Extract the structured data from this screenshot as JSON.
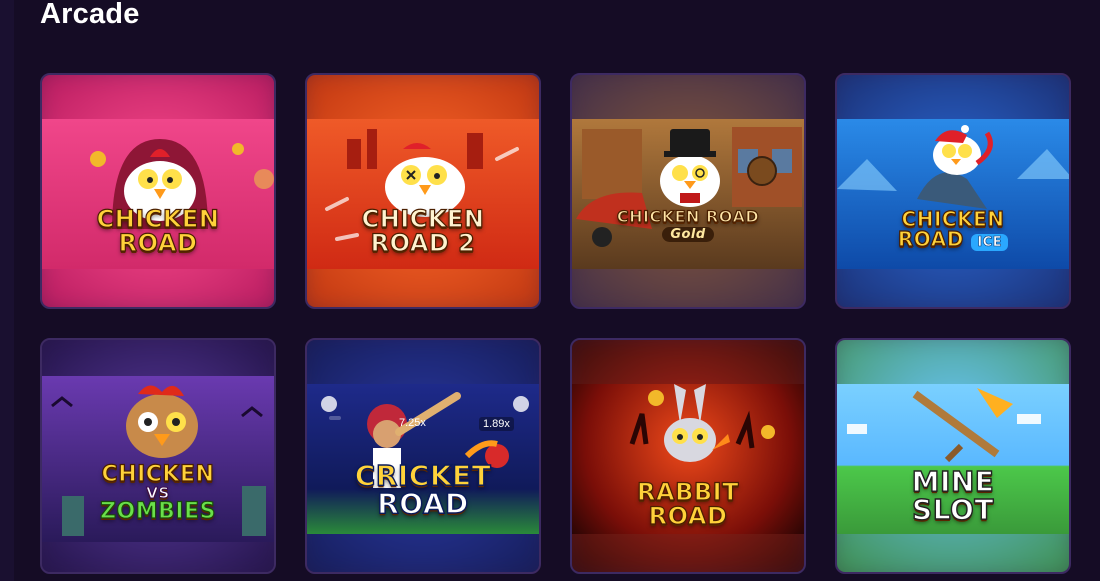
{
  "page": {
    "section_title": "Arcade"
  },
  "games": [
    {
      "id": "chicken-road",
      "logo_line1": "CHICKEN",
      "logo_line2": "ROAD",
      "logo_sub": "",
      "bg": "#e8357a",
      "bg2": "#c41a5a"
    },
    {
      "id": "chicken-road-2",
      "logo_line1": "CHICKEN",
      "logo_line2": "ROAD 2",
      "logo_sub": "",
      "bg": "#e8481f",
      "bg2": "#c22a10"
    },
    {
      "id": "chicken-road-gold",
      "logo_line1": "CHICKEN ROAD",
      "logo_line2": "",
      "logo_sub": "Gold",
      "bg": "#8a5a2a",
      "bg2": "#4a2e14"
    },
    {
      "id": "chicken-road-ice",
      "logo_line1": "CHICKEN",
      "logo_line2": "ROAD",
      "logo_sub": "ICE",
      "bg": "#1e6fd0",
      "bg2": "#0d3f8c"
    },
    {
      "id": "chicken-vs-zombies",
      "logo_line1": "CHICKEN",
      "logo_line2": "ZOMBIES",
      "logo_sub": "VS",
      "bg": "#4a2a8a",
      "bg2": "#241448"
    },
    {
      "id": "cricket-road",
      "logo_line1": "CRICKET",
      "logo_line2": "ROAD",
      "logo_sub": "",
      "multiplier1": "7.25x",
      "multiplier2": "1.89x",
      "bg": "#1b2f86",
      "bg2": "#0c1850"
    },
    {
      "id": "rabbit-road",
      "logo_line1": "RABBIT",
      "logo_line2": "ROAD",
      "logo_sub": "",
      "bg": "#c8281a",
      "bg2": "#5a0c08"
    },
    {
      "id": "mine-slot",
      "logo_line1": "MINE",
      "logo_line2": "SLOT",
      "logo_sub": "",
      "bg": "#6fc6ff",
      "bg2": "#3fa03a"
    }
  ]
}
